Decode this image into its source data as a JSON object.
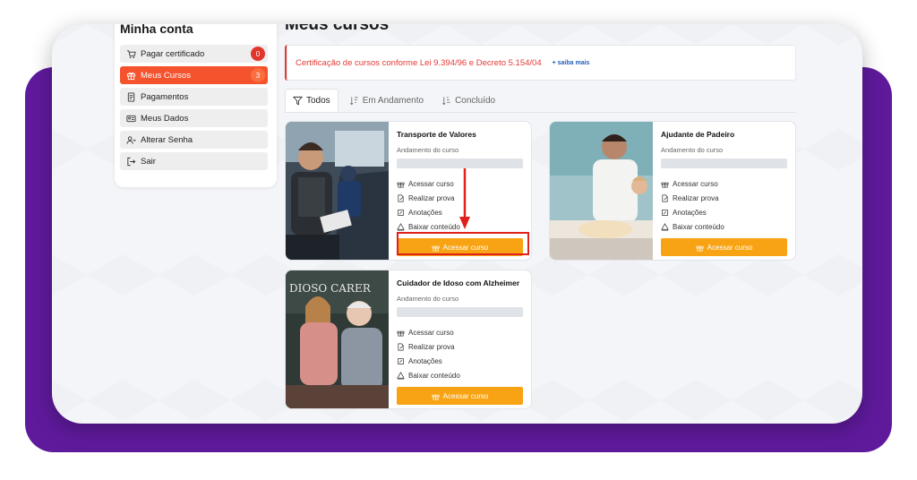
{
  "sidebar": {
    "title": "Minha conta",
    "items": [
      {
        "label": "Pagar certificado",
        "icon": "cart-icon",
        "badge": "0"
      },
      {
        "label": "Meus Cursos",
        "icon": "gift-icon",
        "badge": "3"
      },
      {
        "label": "Pagamentos",
        "icon": "receipt-icon"
      },
      {
        "label": "Meus Dados",
        "icon": "id-card-icon"
      },
      {
        "label": "Alterar Senha",
        "icon": "user-key-icon"
      },
      {
        "label": "Sair",
        "icon": "logout-icon"
      }
    ]
  },
  "main": {
    "title": "Meus cursos",
    "notice": {
      "text": "Certificação de cursos conforme Lei 9.394/96 e Decreto 5.154/04",
      "link": "+ saiba mais"
    },
    "tabs": [
      {
        "label": "Todos",
        "icon": "filter-icon",
        "active": true
      },
      {
        "label": "Em Andamento",
        "icon": "sort-icon"
      },
      {
        "label": "Concluído",
        "icon": "sort-desc-icon"
      }
    ]
  },
  "courses": [
    {
      "title": "Transporte de Valores",
      "progress_label": "Andamento do curso",
      "progress": 0,
      "actions": [
        "Acessar curso",
        "Realizar prova",
        "Anotações",
        "Baixar conteúdo"
      ],
      "button": "Acessar curso"
    },
    {
      "title": "Ajudante de Padeiro",
      "progress_label": "Andamento do curso",
      "progress": 0,
      "actions": [
        "Acessar curso",
        "Realizar prova",
        "Anotações",
        "Baixar conteúdo"
      ],
      "button": "Acessar curso"
    },
    {
      "title": "Cuidador de Idoso com Alzheimer",
      "progress_label": "Andamento do curso",
      "progress": 0,
      "actions": [
        "Acessar curso",
        "Realizar prova",
        "Anotações",
        "Baixar conteúdo"
      ],
      "button": "Acessar curso",
      "image_text": "DIOSO CARER"
    }
  ],
  "colors": {
    "accent": "#f5532d",
    "button": "#f7a313",
    "purple": "#5f1a9c",
    "alert": "#e53935"
  }
}
